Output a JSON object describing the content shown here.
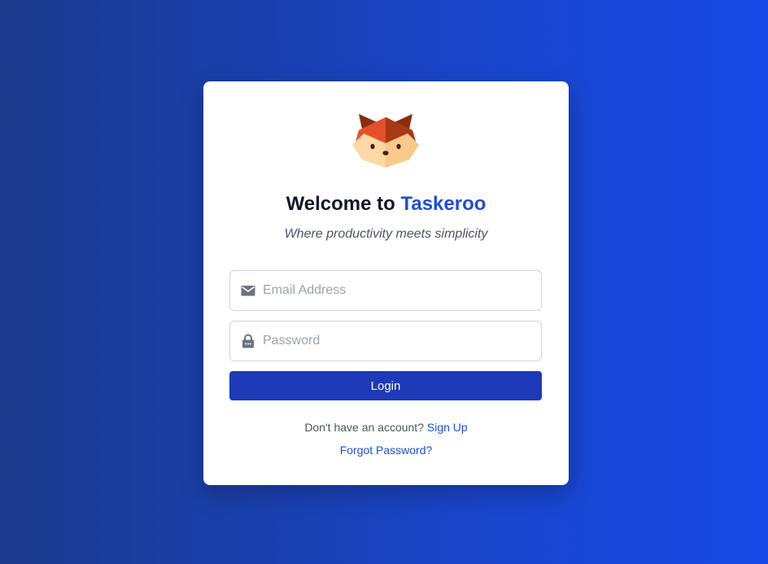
{
  "header": {
    "title_prefix": "Welcome to ",
    "brand": "Taskeroo",
    "subtitle": "Where productivity meets simplicity",
    "logo_icon": "fox-logo"
  },
  "form": {
    "email": {
      "icon": "envelope-icon",
      "placeholder": "Email Address",
      "value": ""
    },
    "password": {
      "icon": "lock-icon",
      "placeholder": "Password",
      "value": ""
    },
    "login_label": "Login"
  },
  "footer": {
    "signup_prompt": "Don't have an account?",
    "signup_link": "Sign Up",
    "forgot_link": "Forgot Password?"
  },
  "colors": {
    "brand": "#1d4ed8",
    "button": "#1e3ab8",
    "background_start": "#1a3a8c",
    "background_end": "#1648e6"
  }
}
